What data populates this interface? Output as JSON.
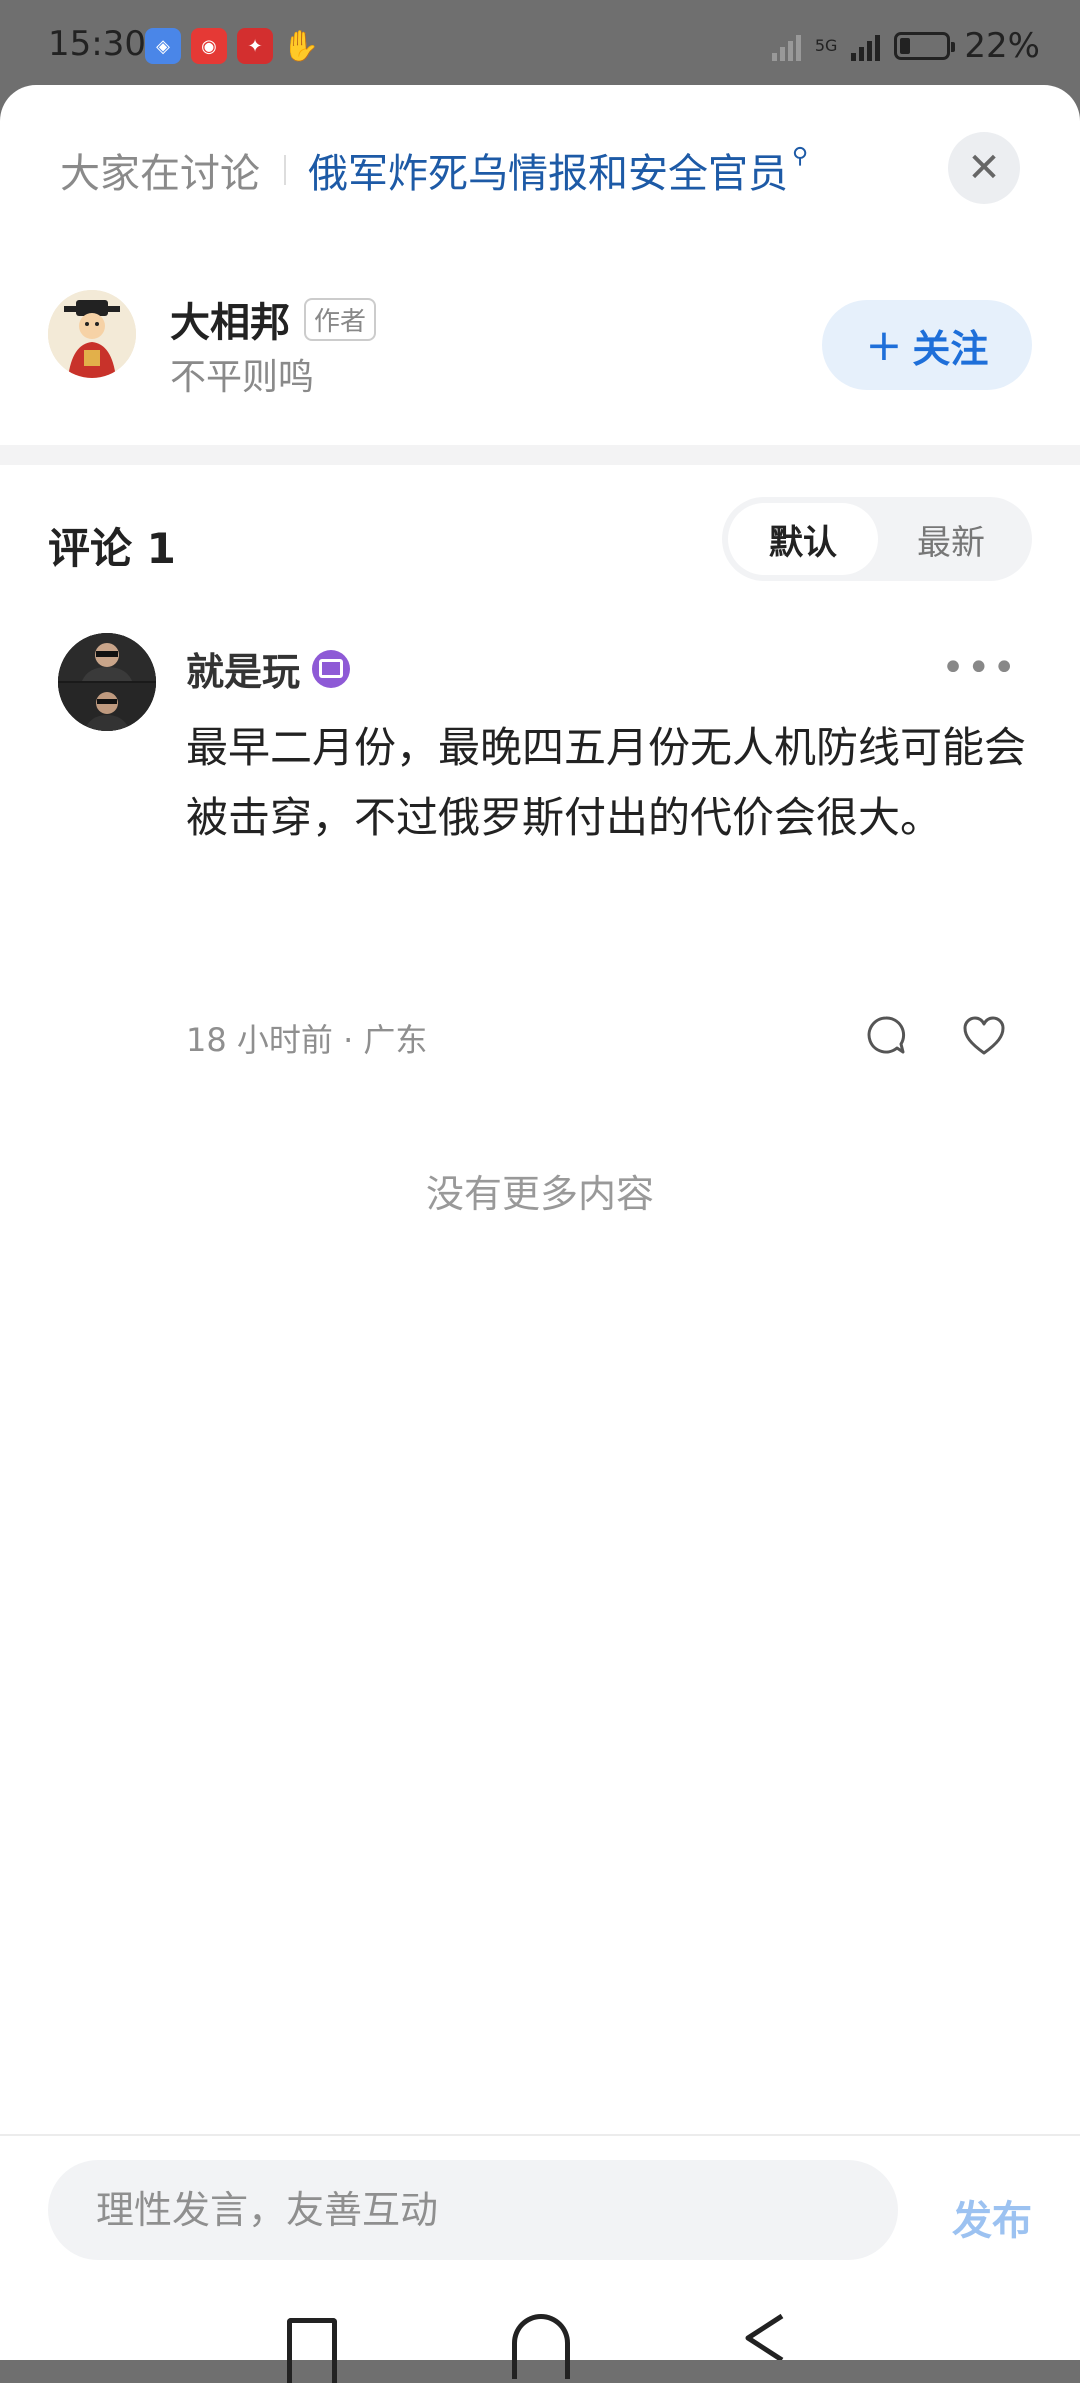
{
  "status_bar": {
    "time": "15:30",
    "network": "5G",
    "battery": "22%"
  },
  "topic": {
    "label": "大家在讨论",
    "title": "俄军炸死乌情报和安全官员"
  },
  "author": {
    "name": "大相邦",
    "badge": "作者",
    "subtitle": "不平则鸣",
    "follow_label": "关注"
  },
  "comments": {
    "title": "评论 1",
    "sort_default": "默认",
    "sort_latest": "最新",
    "items": [
      {
        "user": "就是玩",
        "text": "最早二月份，最晚四五月份无人机防线可能会被击穿，不过俄罗斯付出的代价会很大。",
        "meta": "18 小时前 · 广东"
      }
    ],
    "end_text": "没有更多内容"
  },
  "input": {
    "placeholder": "理性发言，友善互动",
    "publish_label": "发布"
  },
  "icons": {
    "close": "close-icon",
    "more": "more-icon",
    "reply": "comment-bubble-icon",
    "like": "heart-icon"
  },
  "colors": {
    "accent": "#1e6fd9",
    "topic": "#1d5aa6",
    "follow_bg": "#e6f0fb",
    "publish_disabled": "#9cc2f1"
  }
}
